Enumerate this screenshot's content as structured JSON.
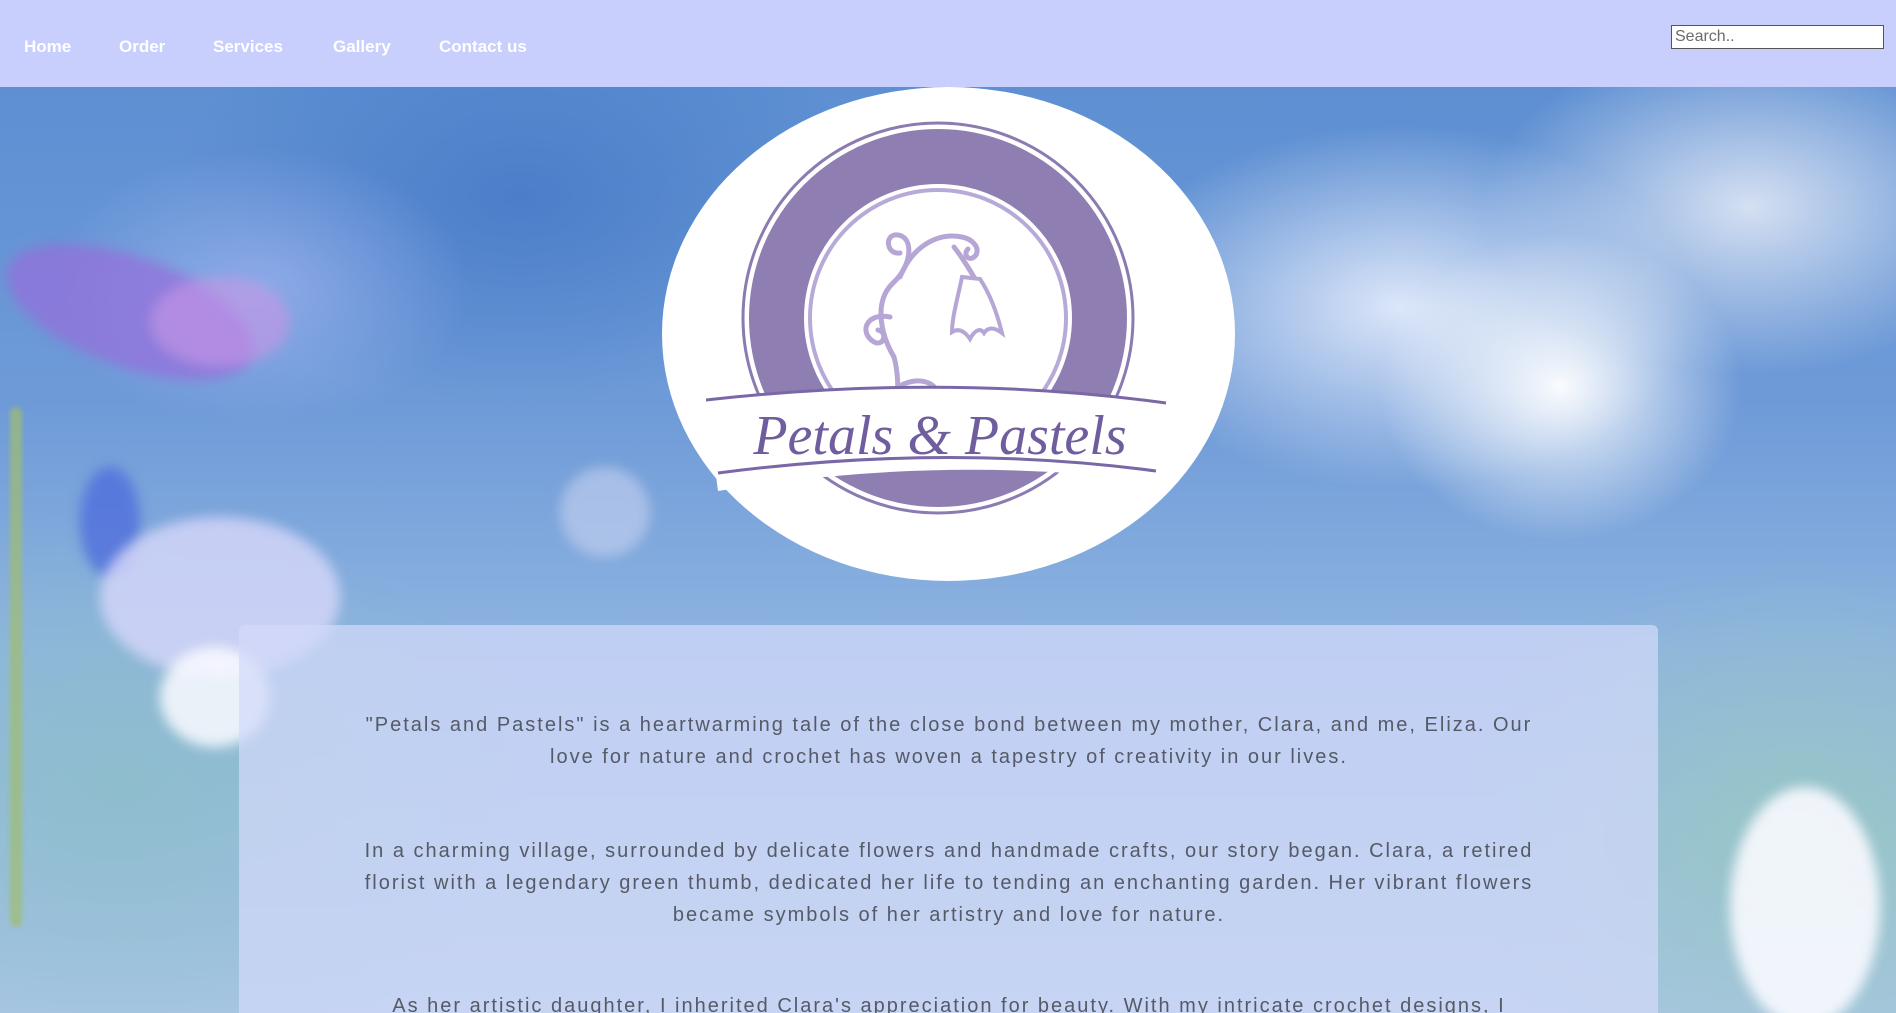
{
  "nav": {
    "items": [
      {
        "label": "Home"
      },
      {
        "label": "Order"
      },
      {
        "label": "Services"
      },
      {
        "label": "Gallery"
      },
      {
        "label": "Contact us"
      }
    ],
    "search_placeholder": "Search.."
  },
  "logo": {
    "brand": "Petals & Pastels",
    "icon": "bellflower-emblem-icon"
  },
  "content": {
    "paragraphs": [
      "\"Petals and Pastels\" is a heartwarming tale of the close bond between my mother, Clara, and me, Eliza. Our love for nature and crochet has woven a tapestry of creativity in our lives.",
      "In a charming village, surrounded by delicate flowers and handmade crafts, our story began. Clara, a retired florist with a legendary green thumb, dedicated her life to tending an enchanting garden. Her vibrant flowers became symbols of her artistry and love for nature.",
      "As her artistic daughter, I inherited Clara's appreciation for beauty. With my intricate crochet designs, I"
    ]
  },
  "colors": {
    "nav_bg": "#c8cffd",
    "logo_purple": "#8b7bb0",
    "text": "#555a66"
  }
}
